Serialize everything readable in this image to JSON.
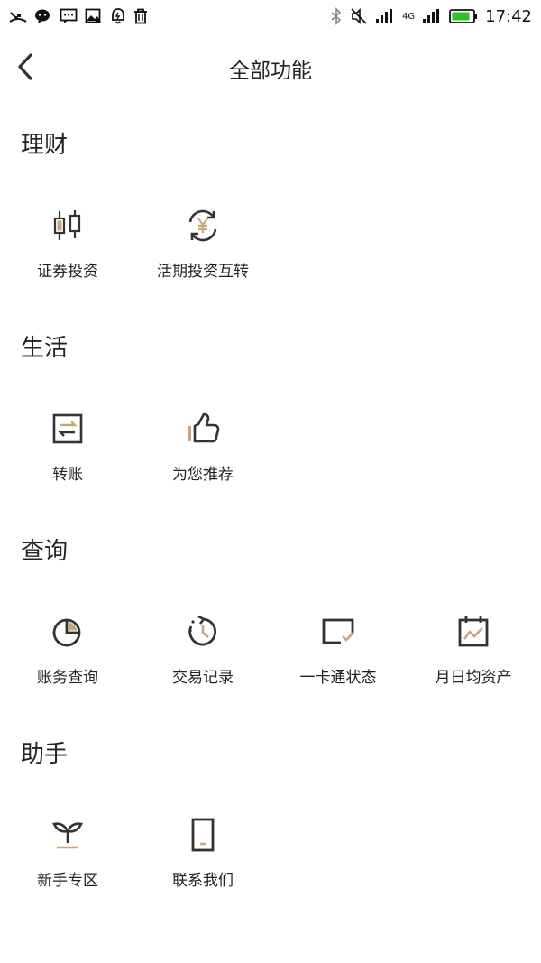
{
  "status_bar": {
    "time": "17:42",
    "network": "4G"
  },
  "header": {
    "title": "全部功能",
    "back_icon": "chevron-left-icon"
  },
  "sections": [
    {
      "title": "理财",
      "items": [
        {
          "label": "证券投资",
          "icon": "candlestick-icon"
        },
        {
          "label": "活期投资互转",
          "icon": "yuan-cycle-icon"
        }
      ]
    },
    {
      "title": "生活",
      "items": [
        {
          "label": "转账",
          "icon": "transfer-icon"
        },
        {
          "label": "为您推荐",
          "icon": "thumbs-up-icon"
        }
      ]
    },
    {
      "title": "查询",
      "items": [
        {
          "label": "账务查询",
          "icon": "pie-chart-icon"
        },
        {
          "label": "交易记录",
          "icon": "history-clock-icon"
        },
        {
          "label": "一卡通状态",
          "icon": "card-check-icon"
        },
        {
          "label": "月日均资产",
          "icon": "calendar-chart-icon"
        }
      ]
    },
    {
      "title": "助手",
      "items": [
        {
          "label": "新手专区",
          "icon": "sprout-icon"
        },
        {
          "label": "联系我们",
          "icon": "phone-icon"
        }
      ]
    }
  ],
  "colors": {
    "accent": "#c9a77a",
    "icon_dark": "#333333",
    "text": "#222222"
  }
}
